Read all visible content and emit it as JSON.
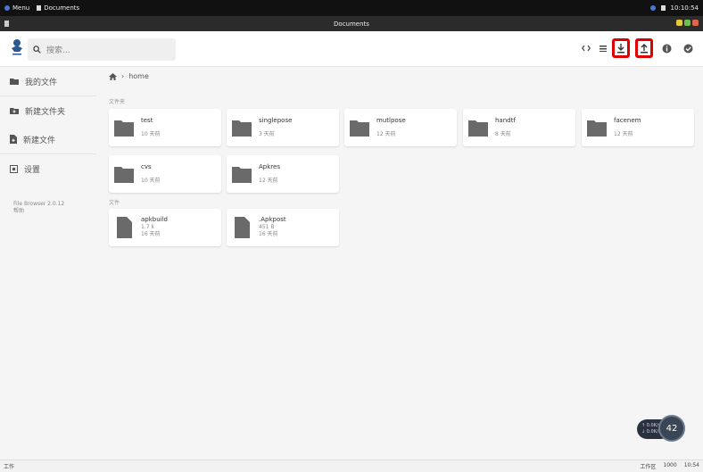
{
  "os_panel": {
    "menu_label": "Menu",
    "app_label": "Documents",
    "clock": "10:10:54"
  },
  "window": {
    "title": "Documents"
  },
  "search": {
    "placeholder": "搜索..."
  },
  "sidebar": {
    "items": [
      {
        "label": "我的文件",
        "icon": "folder-icon"
      },
      {
        "label": "新建文件夹",
        "icon": "new-folder-icon"
      },
      {
        "label": "新建文件",
        "icon": "new-file-icon"
      },
      {
        "label": "设置",
        "icon": "settings-icon"
      }
    ],
    "version": "File Browser 2.0.12",
    "help": "帮助"
  },
  "breadcrumb": {
    "home_icon": "home-icon",
    "current": "home"
  },
  "sections": {
    "folders": "文件夹",
    "files": "文件"
  },
  "folders": [
    {
      "name": "test",
      "meta": "10 天前"
    },
    {
      "name": "singlepose",
      "meta": "3 天前"
    },
    {
      "name": "mutlpose",
      "meta": "12 天前"
    },
    {
      "name": "handtf",
      "meta": "8 天前"
    },
    {
      "name": "facenem",
      "meta": "12 天前"
    },
    {
      "name": "cvs",
      "meta": "10 天前"
    },
    {
      "name": "Apkres",
      "meta": "12 天前"
    }
  ],
  "files": [
    {
      "name": "apkbuild",
      "size": "1.7 k",
      "meta": "16 天前"
    },
    {
      "name": ".Apkpost",
      "size": "451 B",
      "meta": "16 天前"
    }
  ],
  "taskbar": {
    "left": "工作",
    "right": [
      "工作区",
      "1000",
      "10:54"
    ]
  },
  "net_widget": {
    "up": "↑ 0.0K/s",
    "down": "↓ 0.0K/s",
    "percent": "42"
  },
  "colors": {
    "highlight": "#e10000",
    "folder": "#6a6a6a",
    "accent": "#2b5a93"
  }
}
